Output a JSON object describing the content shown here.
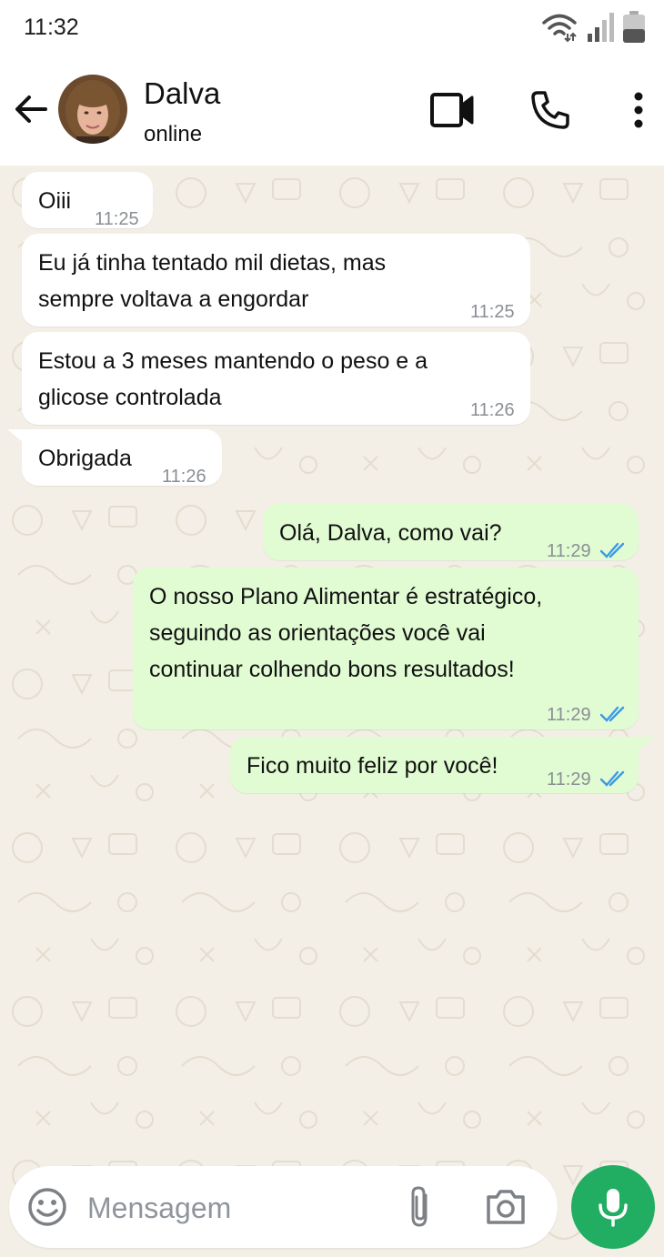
{
  "status_bar": {
    "time": "11:32"
  },
  "header": {
    "contact_name": "Dalva",
    "contact_status": "online"
  },
  "messages": [
    {
      "direction": "incoming",
      "text_lines": [
        "Oiii"
      ],
      "time": "11:25"
    },
    {
      "direction": "incoming",
      "text_lines": [
        "Eu já tinha tentado mil dietas, mas",
        "sempre voltava a engordar"
      ],
      "time": "11:25"
    },
    {
      "direction": "incoming",
      "text_lines": [
        "Estou a 3 meses mantendo o peso e a",
        "glicose controlada"
      ],
      "time": "11:26"
    },
    {
      "direction": "incoming",
      "text_lines": [
        "Obrigada"
      ],
      "time": "11:26"
    },
    {
      "direction": "outgoing",
      "text_lines": [
        "Olá, Dalva, como vai?"
      ],
      "time": "11:29",
      "read": true
    },
    {
      "direction": "outgoing",
      "text_lines": [
        "O nosso Plano Alimentar é estratégico,",
        "seguindo as orientações você vai",
        "continuar colhendo bons resultados!"
      ],
      "time": "11:29",
      "read": true
    },
    {
      "direction": "outgoing",
      "text_lines": [
        "Fico muito feliz por você!"
      ],
      "time": "11:29",
      "read": true
    }
  ],
  "composer": {
    "placeholder": "Mensagem"
  },
  "colors": {
    "incoming_bubble": "#ffffff",
    "outgoing_bubble": "#e1fbd3",
    "chat_background": "#f3efe6",
    "read_ticks": "#3a9ae8",
    "mic_button": "#21ad62"
  },
  "icons": [
    "wifi-icon",
    "signal-icon",
    "battery-icon",
    "back-arrow-icon",
    "video-call-icon",
    "phone-icon",
    "more-options-icon",
    "emoji-icon",
    "attach-icon",
    "camera-icon",
    "mic-icon",
    "double-check-icon"
  ]
}
